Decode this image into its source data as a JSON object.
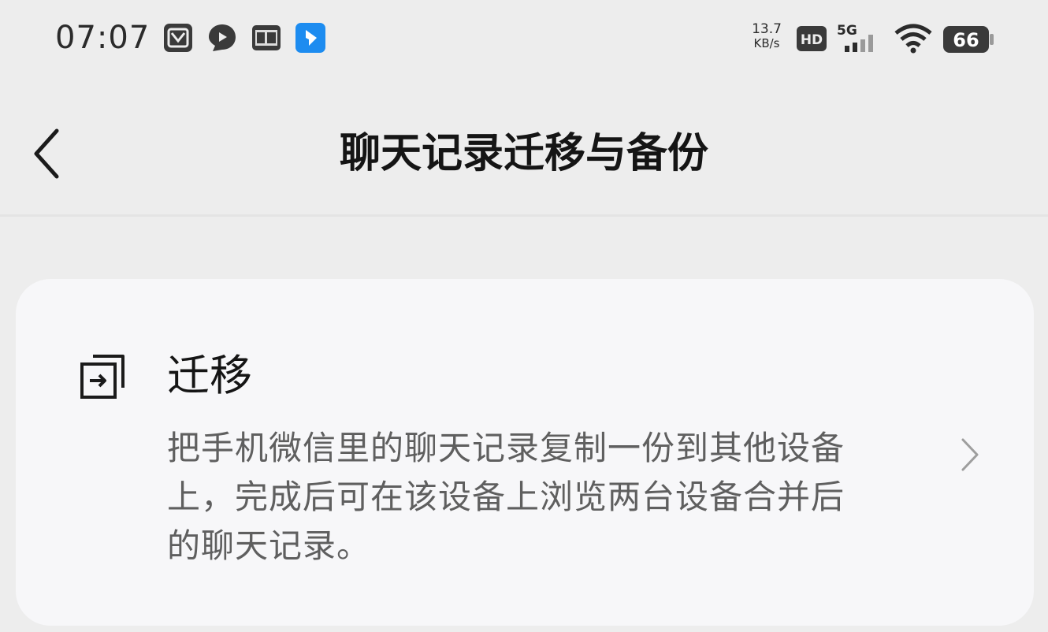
{
  "status_bar": {
    "time": "07:07",
    "net_speed_value": "13.7",
    "net_speed_unit": "KB/s",
    "hd_label": "HD",
    "network_label": "5G",
    "battery_level": "66",
    "notification_icons": [
      "app-icon",
      "chat-bubble-icon",
      "news-icon",
      "bookmark-app-icon"
    ]
  },
  "nav": {
    "title": "聊天记录迁移与备份",
    "back_icon": "chevron-left-icon"
  },
  "migrate_card": {
    "icon": "migrate-icon",
    "title": "迁移",
    "description": "把手机微信里的聊天记录复制一份到其他设备上，完成后可在该设备上浏览两台设备合并后的聊天记录。",
    "arrow_icon": "chevron-right-icon"
  },
  "colors": {
    "background": "#ededed",
    "card": "#f7f7f9",
    "title_text": "#151515",
    "secondary_text": "#5f5f5f",
    "app_badge_blue": "#1d8cf0"
  }
}
